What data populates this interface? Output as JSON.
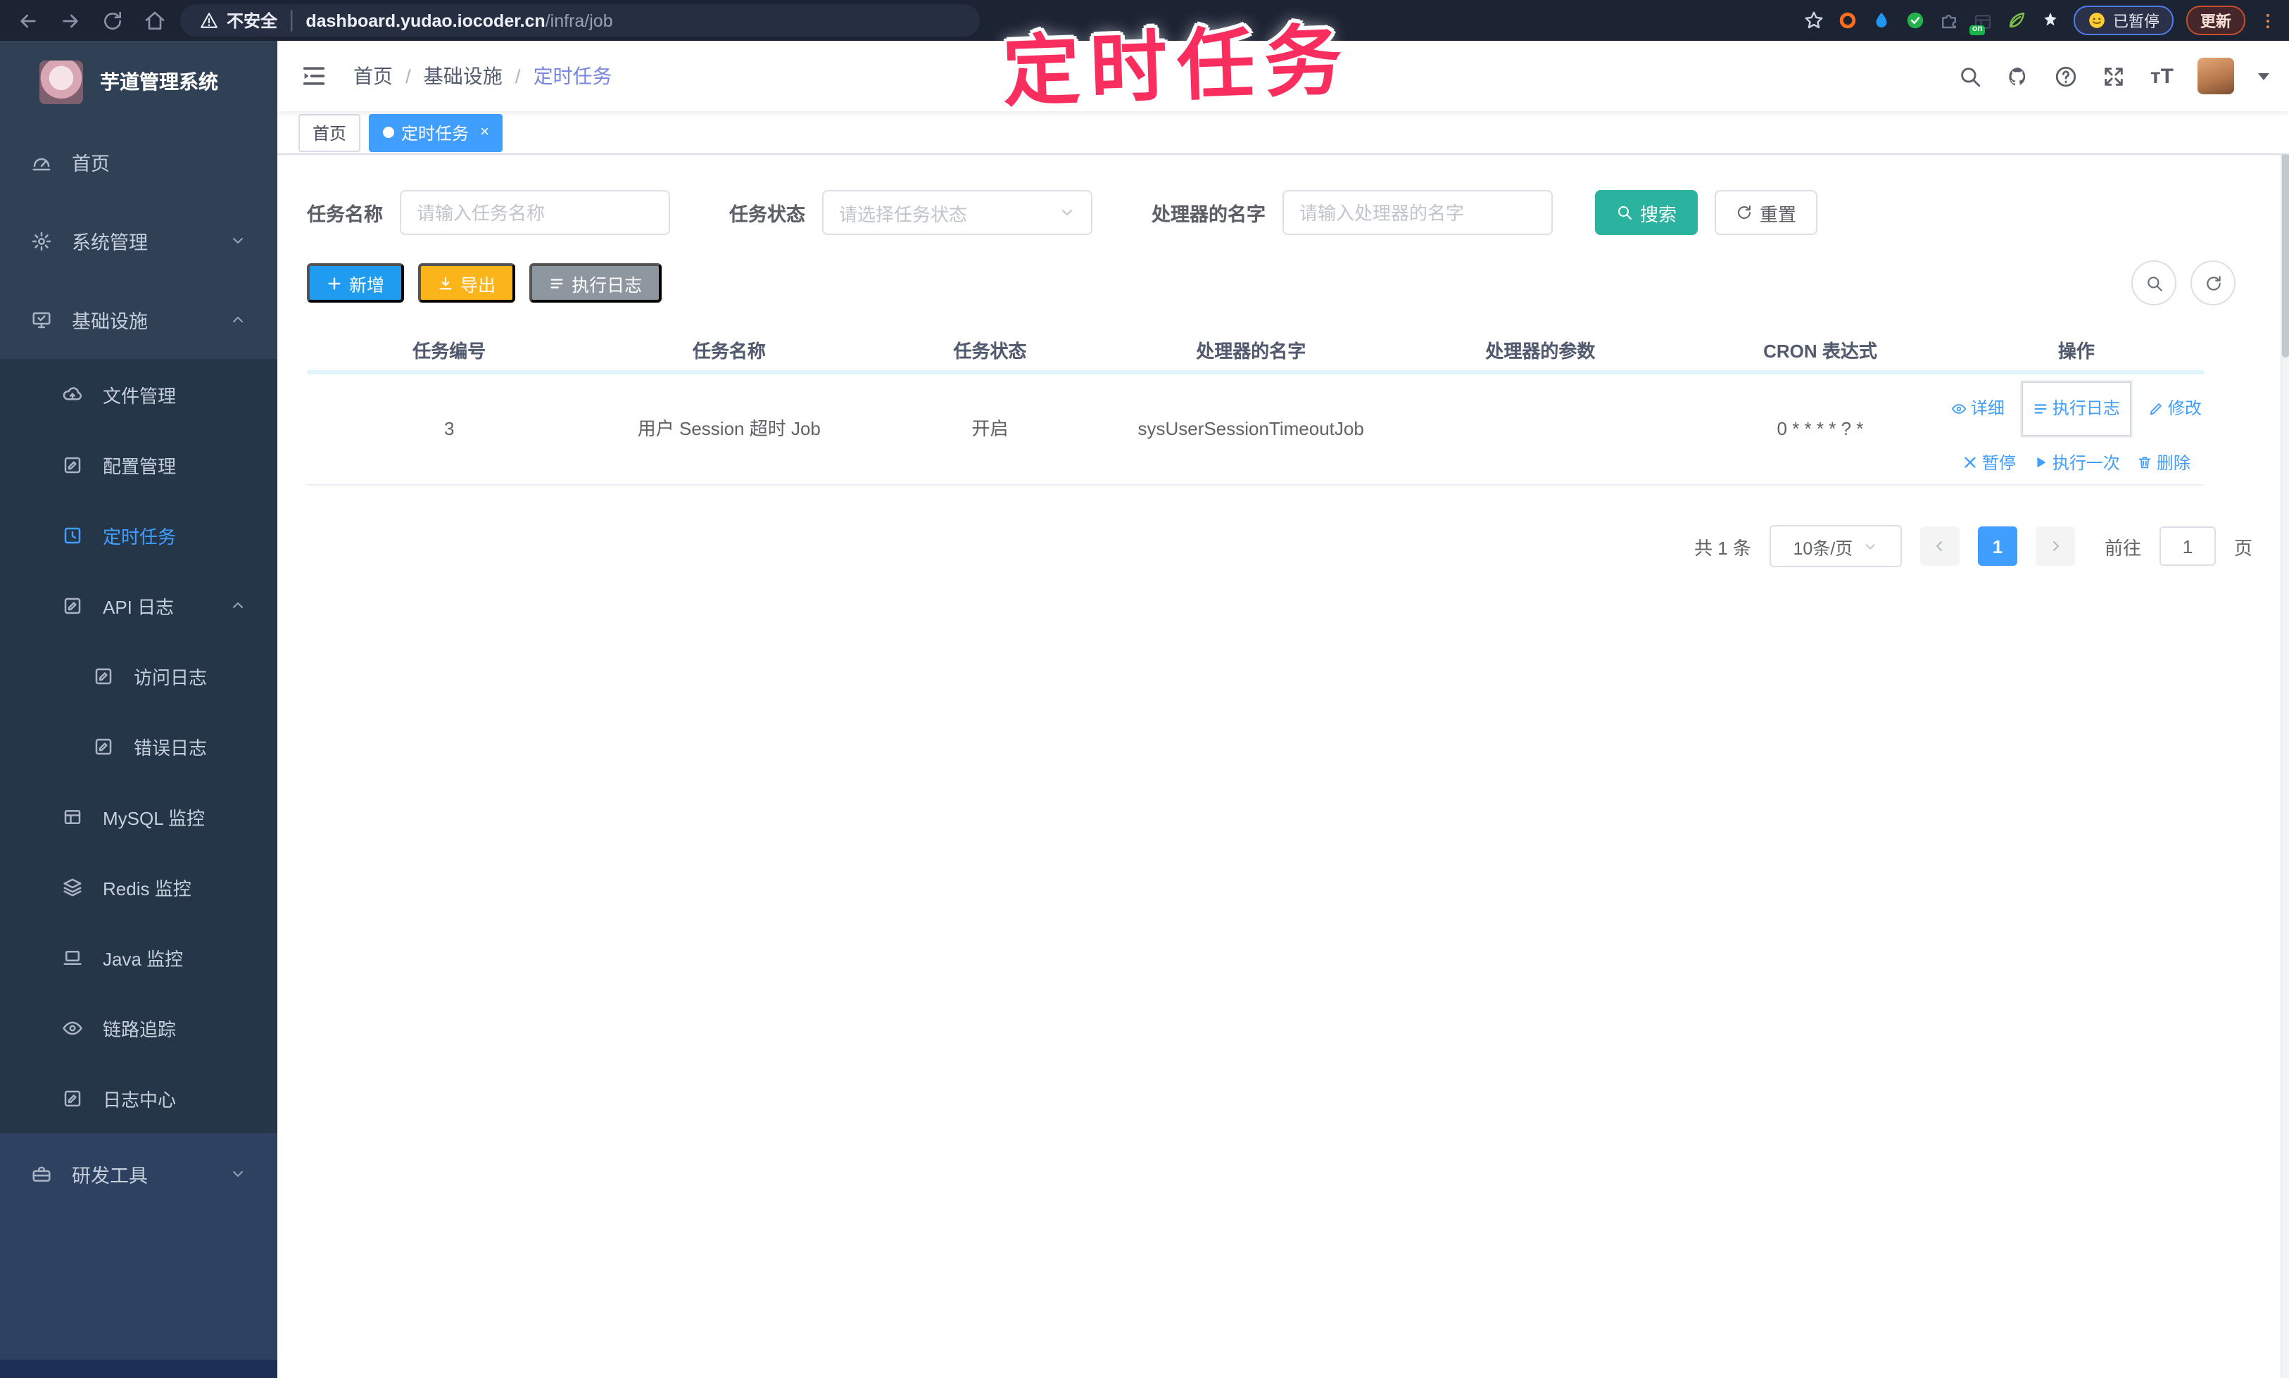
{
  "browser": {
    "security_label": "不安全",
    "url_host": "dashboard.yudao.iocoder.cn",
    "url_path": "/infra/job",
    "extension_on_badge": "on",
    "paused_badge": "已暂停",
    "update_button": "更新"
  },
  "annotation": {
    "text": "定时任务",
    "color": "#fa2e5e"
  },
  "sidebar": {
    "app_title": "芋道管理系统",
    "menu": [
      {
        "label": "首页",
        "icon": "gauge-icon"
      },
      {
        "label": "系统管理",
        "icon": "gear-icon"
      },
      {
        "label": "基础设施",
        "icon": "monitor-check-icon"
      },
      {
        "label": "文件管理",
        "icon": "cloud-upload-icon"
      },
      {
        "label": "配置管理",
        "icon": "edit-square-icon"
      },
      {
        "label": "定时任务",
        "icon": "timer-icon",
        "active": true
      },
      {
        "label": "API 日志",
        "icon": "log-icon"
      },
      {
        "label": "访问日志",
        "icon": "log-icon"
      },
      {
        "label": "错误日志",
        "icon": "log-icon"
      },
      {
        "label": "MySQL 监控",
        "icon": "table-grid-icon"
      },
      {
        "label": "Redis 监控",
        "icon": "layers-icon"
      },
      {
        "label": "Java 监控",
        "icon": "laptop-icon"
      },
      {
        "label": "链路追踪",
        "icon": "eye-icon"
      },
      {
        "label": "日志中心",
        "icon": "log-icon"
      },
      {
        "label": "研发工具",
        "icon": "briefcase-icon"
      }
    ],
    "colors": {
      "bg": "#304156",
      "submenu_bg": "#263649",
      "active": "#409eff",
      "text": "#c6cfdc"
    }
  },
  "navbar": {
    "breadcrumb": [
      "首页",
      "基础设施",
      "定时任务"
    ],
    "separator": "/"
  },
  "tags": [
    {
      "label": "首页"
    },
    {
      "label": "定时任务",
      "close": "×"
    }
  ],
  "filter": {
    "name_label": "任务名称",
    "name_placeholder": "请输入任务名称",
    "status_label": "任务状态",
    "status_placeholder": "请选择任务状态",
    "handler_label": "处理器的名字",
    "handler_placeholder": "请输入处理器的名字",
    "search_button": "搜索",
    "reset_button": "重置"
  },
  "toolbar": {
    "add_button": "新增",
    "export_button": "导出",
    "log_button": "执行日志"
  },
  "table": {
    "columns": [
      "任务编号",
      "任务名称",
      "任务状态",
      "处理器的名字",
      "处理器的参数",
      "CRON 表达式",
      "操作"
    ],
    "rows": [
      {
        "id": "3",
        "name": "用户 Session 超时 Job",
        "status": "开启",
        "handler": "sysUserSessionTimeoutJob",
        "param": "",
        "cron": "0 * * * * ? *"
      }
    ],
    "row_actions": [
      "详细",
      "执行日志",
      "修改",
      "暂停",
      "执行一次",
      "删除"
    ]
  },
  "pagination": {
    "total": "共 1 条",
    "page_size": "10条/页",
    "current_page": "1",
    "goto_label": "前往",
    "goto_value": "1",
    "page_unit": "页"
  },
  "colors": {
    "primary": "#409eff",
    "search_teal": "#2cb3a0",
    "add_blue": "#1f9bf0",
    "export_amber": "#fbb41a",
    "runlog_gray": "#8e969f",
    "annotation_pink": "#fa2e5e",
    "sidebar_bg": "#304156"
  }
}
